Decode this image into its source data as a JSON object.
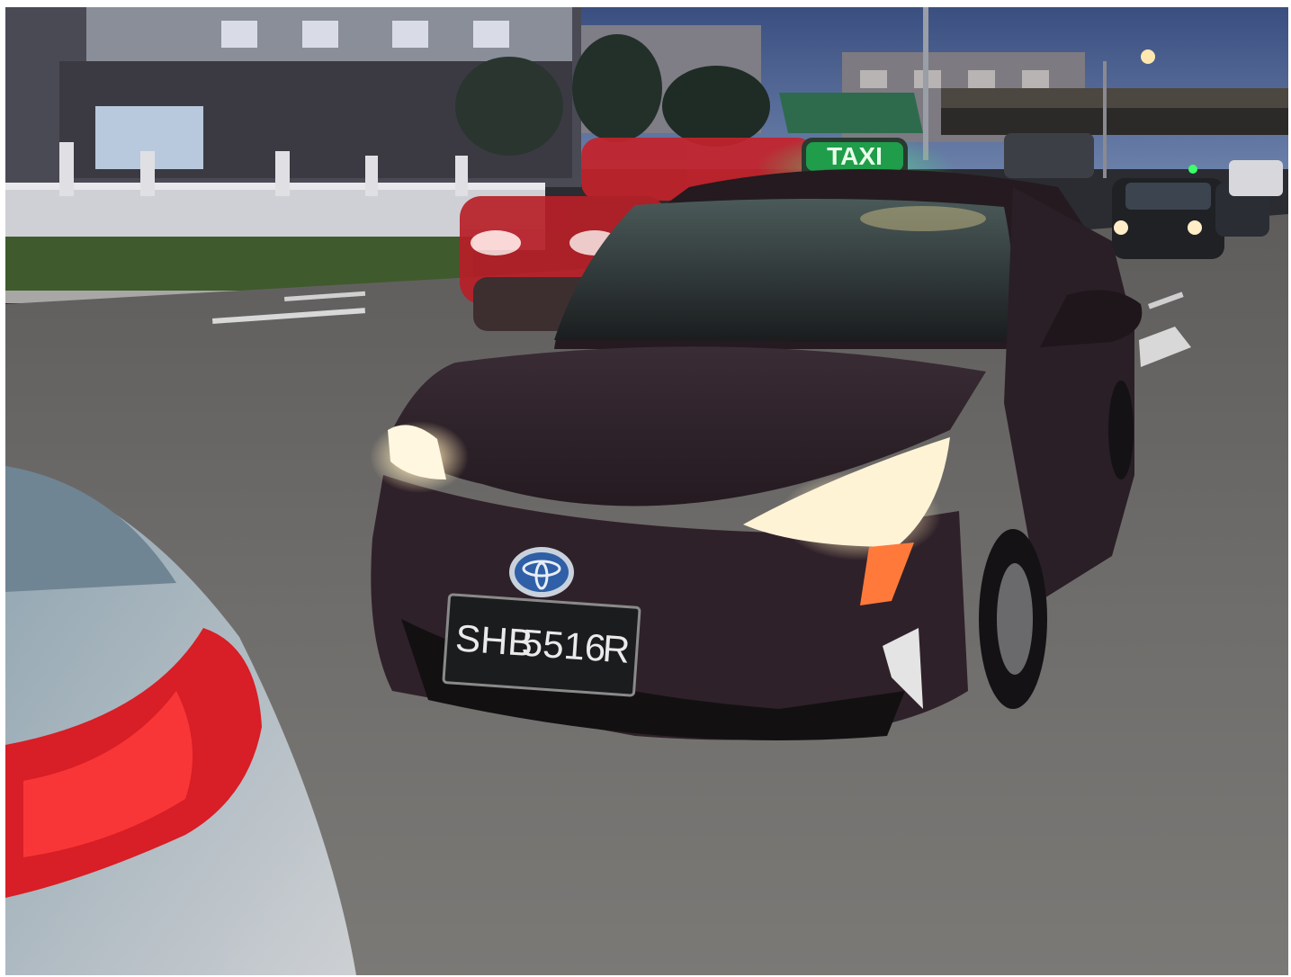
{
  "image": {
    "taxi_sign_text": "TAXI",
    "license_plate": {
      "left": "SHB",
      "middle": "5516",
      "right": "R"
    },
    "colors": {
      "taxi_sign": "#35e46e",
      "car_body": "#2f2129",
      "sky": "#3a5a8e",
      "road": "#6d6c6c"
    }
  }
}
